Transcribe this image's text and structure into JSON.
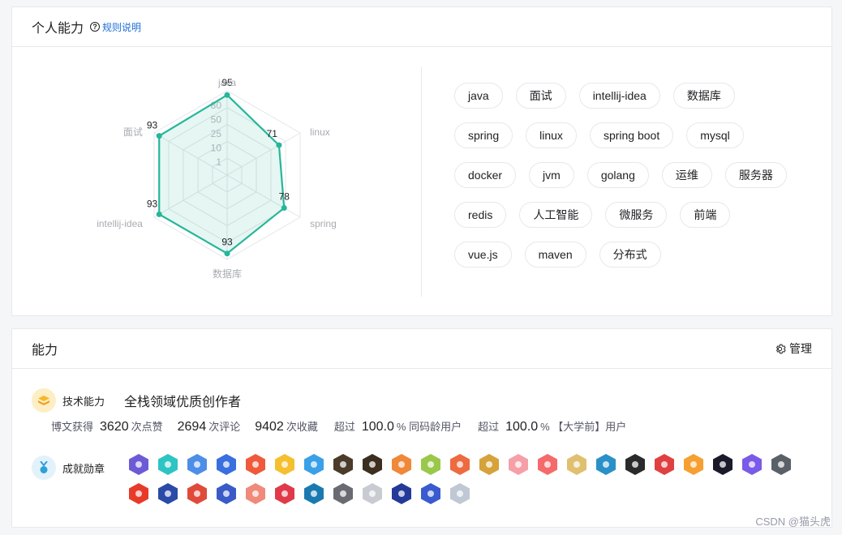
{
  "skills_card": {
    "title": "个人能力",
    "rule_link": "规则说明",
    "radar": {
      "axes": [
        "java",
        "linux",
        "spring",
        "数据库",
        "intellij-idea",
        "面试"
      ],
      "values": [
        95,
        71,
        78,
        93,
        93,
        93
      ],
      "scale_labels": [
        "80",
        "50",
        "25",
        "10",
        "1"
      ],
      "color": "#26b69a"
    },
    "tags": [
      "java",
      "面试",
      "intellij-idea",
      "数据库",
      "spring",
      "linux",
      "spring boot",
      "mysql",
      "docker",
      "jvm",
      "golang",
      "运维",
      "服务器",
      "redis",
      "人工智能",
      "微服务",
      "前端",
      "vue.js",
      "maven",
      "分布式"
    ]
  },
  "ability_card": {
    "title": "能力",
    "manage_label": "管理",
    "tech": {
      "label": "技术能力",
      "title": "全栈领域优质创作者"
    },
    "stats": {
      "prefix": "博文获得",
      "likes": "3620",
      "likes_unit": "次点赞",
      "comments": "2694",
      "comments_unit": "次评论",
      "favorites": "9402",
      "favorites_unit": "次收藏",
      "exceed1_prefix": "超过",
      "exceed1_value": "100.0",
      "exceed1_suffix": "% 同码龄用户",
      "exceed2_prefix": "超过",
      "exceed2_value": "100.0",
      "exceed2_suffix": "% 【大学前】用户"
    },
    "medals": {
      "label": "成就勋章",
      "items": [
        {
          "icon": "medal-purple-icon",
          "color": "#6b5bd6"
        },
        {
          "icon": "medal-teal-icon",
          "color": "#2ec4c4"
        },
        {
          "icon": "medal-pen-icon",
          "color": "#4d8ee8"
        },
        {
          "icon": "medal-blue-icon",
          "color": "#3a6fe0"
        },
        {
          "icon": "medal-red-icon",
          "color": "#ef5a3c"
        },
        {
          "icon": "medal-yellow-icon",
          "color": "#f5c030"
        },
        {
          "icon": "medal-globe-icon",
          "color": "#3aa0e8"
        },
        {
          "icon": "medal-dark-icon",
          "color": "#4a3b2a"
        },
        {
          "icon": "medal-dark2-icon",
          "color": "#3c2f20"
        },
        {
          "icon": "medal-orange-icon",
          "color": "#f0883a"
        },
        {
          "icon": "medal-green-icon",
          "color": "#9ac84a"
        },
        {
          "icon": "medal-monkey-icon",
          "color": "#ee6a40"
        },
        {
          "icon": "medal-gold-icon",
          "color": "#d6a23a"
        },
        {
          "icon": "medal-pink-icon",
          "color": "#f5a0a8"
        },
        {
          "icon": "medal-red2-icon",
          "color": "#f56a6a"
        },
        {
          "icon": "medal-star-icon",
          "color": "#e0c070"
        },
        {
          "icon": "medal-cyan-icon",
          "color": "#2a90c8"
        },
        {
          "icon": "medal-black-icon",
          "color": "#2a2a2a"
        },
        {
          "icon": "medal-1024-icon",
          "color": "#e04040"
        },
        {
          "icon": "medal-orange2-icon",
          "color": "#f5a030"
        },
        {
          "icon": "medal-space-icon",
          "color": "#1a1a2a"
        },
        {
          "icon": "medal-violet-icon",
          "color": "#7a5ae8"
        },
        {
          "icon": "medal-gray-icon",
          "color": "#5a6068"
        },
        {
          "icon": "medal-gift-icon",
          "color": "#e83a2a"
        },
        {
          "icon": "medal-rocket-icon",
          "color": "#2a4aa8"
        },
        {
          "icon": "medal-1024b-icon",
          "color": "#e04a3a"
        },
        {
          "icon": "medal-rocket2-icon",
          "color": "#3a5ac8"
        },
        {
          "icon": "medal-peach-icon",
          "color": "#f08a7a"
        },
        {
          "icon": "medal-redpen-icon",
          "color": "#e03a4a"
        },
        {
          "icon": "medal-linkedin-icon",
          "color": "#1a7ab0"
        },
        {
          "icon": "medal-github-icon",
          "color": "#6a6a72"
        },
        {
          "icon": "medal-30-icon",
          "color": "#c8ccd2"
        },
        {
          "icon": "medal-rocket3-icon",
          "color": "#243a98"
        },
        {
          "icon": "medal-rocket4-icon",
          "color": "#3a5ad0"
        },
        {
          "icon": "medal-20-icon",
          "color": "#c0c8d4"
        }
      ]
    }
  },
  "watermark": "CSDN @猫头虎"
}
